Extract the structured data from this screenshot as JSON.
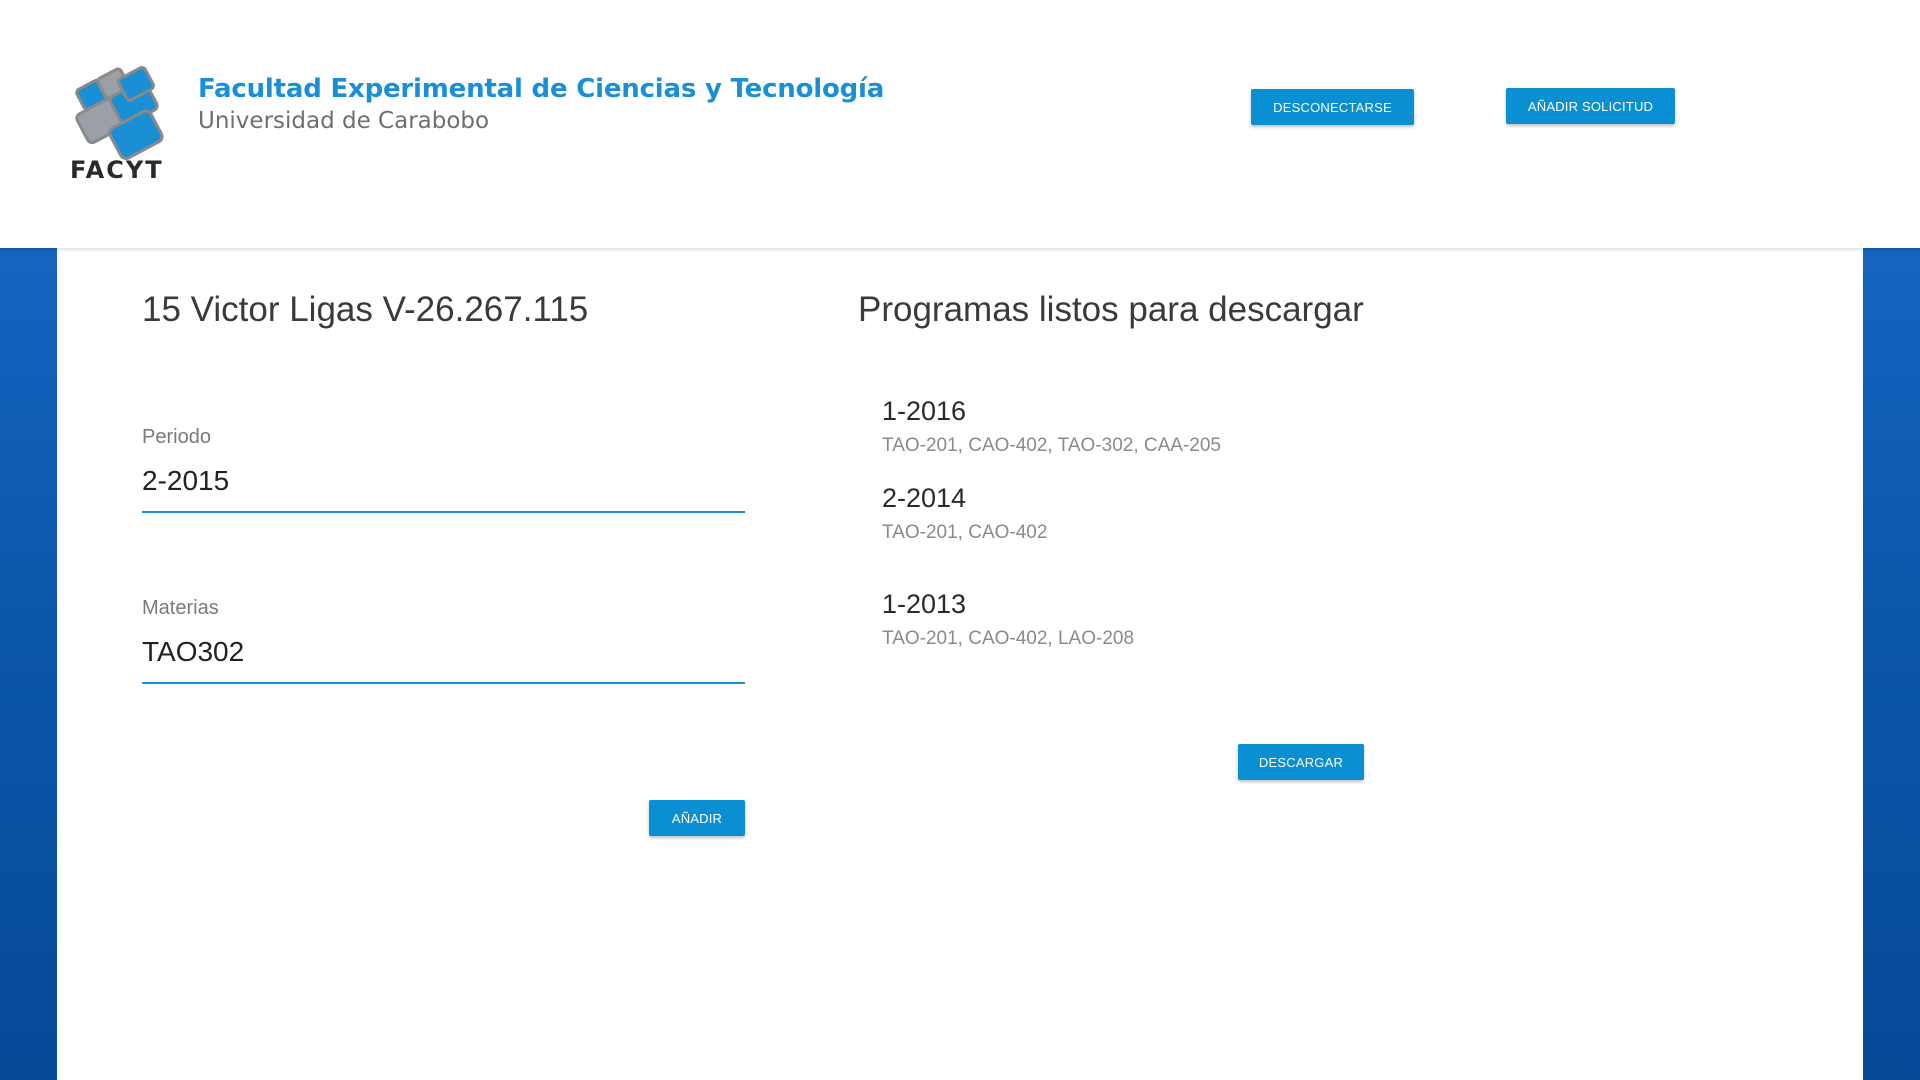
{
  "header": {
    "brand_title": "Facultad Experimental de Ciencias y Tecnología",
    "brand_subtitle": "Universidad de Carabobo",
    "logo_text": "FACYT",
    "logout_label": "DESCONECTARSE",
    "add_request_label": "AÑADIR SOLICITUD"
  },
  "form": {
    "title": "15 Victor Ligas V-26.267.115",
    "period_label": "Periodo",
    "period_value": "2-2015",
    "subjects_label": "Materias",
    "subjects_value": "TAO302",
    "add_label": "AÑADIR"
  },
  "programs": {
    "title": "Programas listos para descargar",
    "items": [
      {
        "period": "1-2016",
        "subjects": "TAO-201, CAO-402, TAO-302, CAA-205"
      },
      {
        "period": "2-2014",
        "subjects": "TAO-201, CAO-402"
      },
      {
        "period": "1-2013",
        "subjects": "TAO-201, CAO-402, LAO-208"
      }
    ],
    "download_label": "DESCARGAR"
  },
  "colors": {
    "accent": "#0a8fd2",
    "brand_blue": "#1a8fd6",
    "background_blue": "#0b55a8"
  }
}
